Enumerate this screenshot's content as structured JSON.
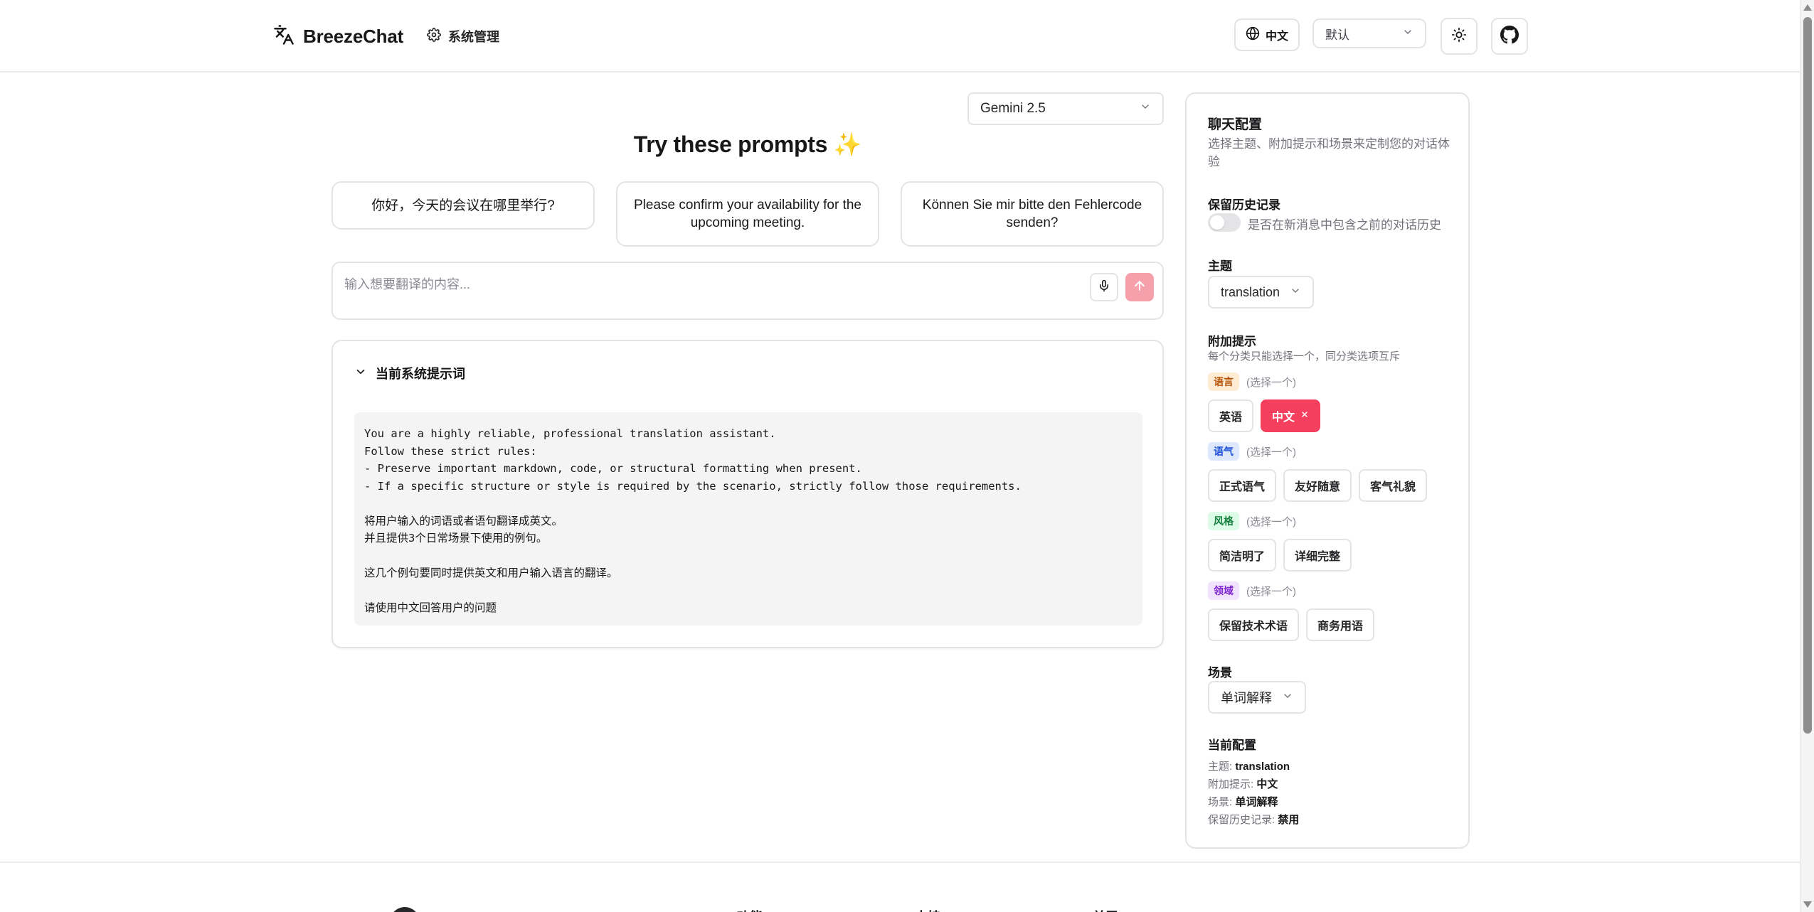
{
  "header": {
    "app_name": "BreezeChat",
    "admin_label": "系统管理",
    "lang_label": "中文",
    "model_default": "默认"
  },
  "main": {
    "model_name": "Gemini 2.5",
    "prompts_title": "Try these prompts ✨",
    "prompts": [
      "你好，今天的会议在哪里举行?",
      "Please confirm your availability for the upcoming meeting.",
      "Können Sie mir bitte den Fehlercode senden?"
    ],
    "input_placeholder": "输入想要翻译的内容...",
    "system_prompt_label": "当前系统提示词",
    "system_prompt_text": "You are a highly reliable, professional translation assistant.\nFollow these strict rules:\n- Preserve important markdown, code, or structural formatting when present.\n- If a specific structure or style is required by the scenario, strictly follow those requirements.\n\n将用户输入的词语或者语句翻译成英文。\n并且提供3个日常场景下使用的例句。\n\n这几个例句要同时提供英文和用户输入语言的翻译。\n\n请使用中文回答用户的问题"
  },
  "config": {
    "title": "聊天配置",
    "description": "选择主题、附加提示和场景来定制您的对话体验",
    "history_label": "保留历史记录",
    "history_desc": "是否在新消息中包含之前的对话历史",
    "history_enabled": false,
    "theme_label": "主题",
    "theme_value": "translation",
    "hints_label": "附加提示",
    "hints_sub": "每个分类只能选择一个，同分类选项互斥",
    "categories": [
      {
        "name": "语言",
        "hint": "(选择一个)",
        "badge_bg": "#fdebd3",
        "badge_fg": "#b45309",
        "options": [
          "英语",
          "中文"
        ],
        "selected": "中文"
      },
      {
        "name": "语气",
        "hint": "(选择一个)",
        "badge_bg": "#dde8fd",
        "badge_fg": "#1d4ed8",
        "options": [
          "正式语气",
          "友好随意",
          "客气礼貌"
        ]
      },
      {
        "name": "风格",
        "hint": "(选择一个)",
        "badge_bg": "#dcfce7",
        "badge_fg": "#15803d",
        "options": [
          "简洁明了",
          "详细完整"
        ]
      },
      {
        "name": "领域",
        "hint": "(选择一个)",
        "badge_bg": "#f1e3fd",
        "badge_fg": "#7e22ce",
        "options": [
          "保留技术术语",
          "商务用语"
        ]
      }
    ],
    "active_chip_color": "#f43f5e",
    "scene_label": "场景",
    "scene_value": "单词解释",
    "current_label": "当前配置",
    "current": {
      "theme_key": "主题:",
      "theme_val": "translation",
      "hint_key": "附加提示:",
      "hint_val": "中文",
      "scene_key": "场景:",
      "scene_val": "单词解释",
      "history_key": "保留历史记录:",
      "history_val": "禁用"
    }
  },
  "footer": {
    "cols": [
      "功能",
      "支持",
      "关于"
    ]
  }
}
